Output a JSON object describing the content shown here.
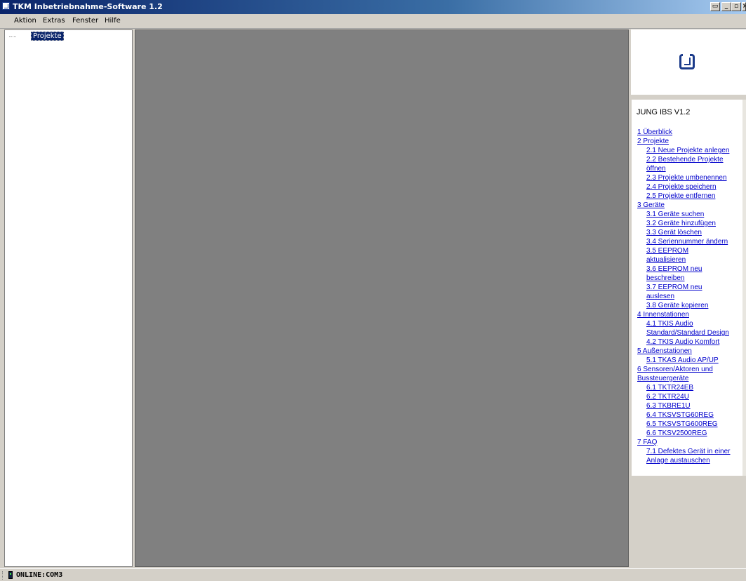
{
  "window": {
    "title": "TKM Inbetriebnahme-Software 1.2",
    "controls": {
      "restore": "▭",
      "minimize": "_",
      "maximize": "▫",
      "close": "×"
    }
  },
  "menubar": {
    "items": [
      "Aktion",
      "Extras",
      "Fenster",
      "Hilfe"
    ]
  },
  "tree": {
    "root_label": "Projekte"
  },
  "help": {
    "title": "JUNG IBS V1.2",
    "links": [
      "1 Überblick",
      "2 Projekte",
      "2.1 Neue Projekte anlegen",
      "2.2 Bestehende Projekte",
      "öffnen",
      "2.3 Projekte umbenennen",
      "2.4 Projekte speichern",
      "2.5 Projekte entfernen",
      "3 Geräte",
      "3.1 Geräte suchen",
      "3.2 Geräte hinzufügen",
      "3.3 Gerät löschen",
      "3.4 Seriennummer ändern",
      "3.5 EEPROM",
      "aktualisieren",
      "3.6 EEPROM neu",
      "beschreiben",
      "3.7 EEPROM neu",
      "auslesen",
      "3.8 Geräte kopieren",
      "4 Innenstationen",
      "4.1 TKIS Audio",
      "Standard/Standard Design",
      "4.2 TKIS Audio Komfort",
      "5 Außenstationen",
      "5.1 TKAS Audio AP/UP",
      "6 Sensoren/Aktoren und",
      "Bussteuergeräte",
      "6.1 TKTR24EB",
      "6.2 TKTR24U",
      "6.3 TKBRE1U",
      "6.4 TKSVSTG60REG",
      "6.5 TKSVSTG600REG",
      "6.6 TKSV2500REG",
      "7 FAQ",
      "7.1 Defektes Gerät in einer",
      "Anlage austauschen"
    ]
  },
  "statusbar": {
    "connection": "ONLINE:COM3"
  },
  "icons": [
    "app-logo-icon",
    "jung-logo-icon",
    "connection-status-icon"
  ]
}
